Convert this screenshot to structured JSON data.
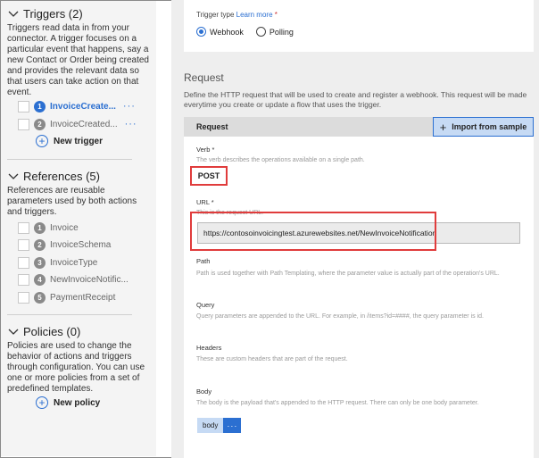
{
  "sidebar": {
    "triggers": {
      "title": "Triggers (2)",
      "description": "Triggers read data in from your connector. A trigger focuses on a particular event that happens, say a new Contact or Order being created and provides the relevant data so that users can take action on that event.",
      "items": [
        {
          "num": "1",
          "label": "InvoiceCreate...",
          "more": "···"
        },
        {
          "num": "2",
          "label": "InvoiceCreated...",
          "more": "···"
        }
      ],
      "new_label": "New trigger"
    },
    "references": {
      "title": "References (5)",
      "description": "References are reusable parameters used by both actions and triggers.",
      "items": [
        {
          "num": "1",
          "label": "Invoice"
        },
        {
          "num": "2",
          "label": "InvoiceSchema"
        },
        {
          "num": "3",
          "label": "InvoiceType"
        },
        {
          "num": "4",
          "label": "NewInvoiceNotific..."
        },
        {
          "num": "5",
          "label": "PaymentReceipt"
        }
      ]
    },
    "policies": {
      "title": "Policies (0)",
      "description": "Policies are used to change the behavior of actions and triggers through configuration. You can use one or more policies from a set of predefined templates.",
      "new_label": "New policy"
    }
  },
  "trigger_type": {
    "label": "Trigger type",
    "learn_more": "Learn more",
    "required": "*",
    "options": [
      "Webhook",
      "Polling"
    ],
    "selected": "Webhook"
  },
  "request_section": {
    "title": "Request",
    "description": "Define the HTTP request that will be used to create and register a webhook. This request will be made everytime you create or update a flow that uses the trigger.",
    "card_title": "Request",
    "import_label": "Import from sample"
  },
  "fields": {
    "verb": {
      "label": "Verb *",
      "help": "The verb describes the operations available on a single path.",
      "value": "POST"
    },
    "url": {
      "label": "URL *",
      "help": "This is the request URL.",
      "value": "https://contosoinvoicingtest.azurewebsites.net/NewInvoiceNotification"
    },
    "path": {
      "label": "Path",
      "help": "Path is used together with Path Templating, where the parameter value is actually part of the operation's URL."
    },
    "query": {
      "label": "Query",
      "help": "Query parameters are appended to the URL. For example, in /items?id=####, the query parameter is id."
    },
    "headers": {
      "label": "Headers",
      "help": "These are custom headers that are part of the request."
    },
    "body": {
      "label": "Body",
      "help": "The body is the payload that's appended to the HTTP request. There can only be one body parameter.",
      "chip": "body",
      "more": "···"
    }
  },
  "colors": {
    "accent": "#2b6fd1",
    "highlight": "#e03c3c"
  }
}
